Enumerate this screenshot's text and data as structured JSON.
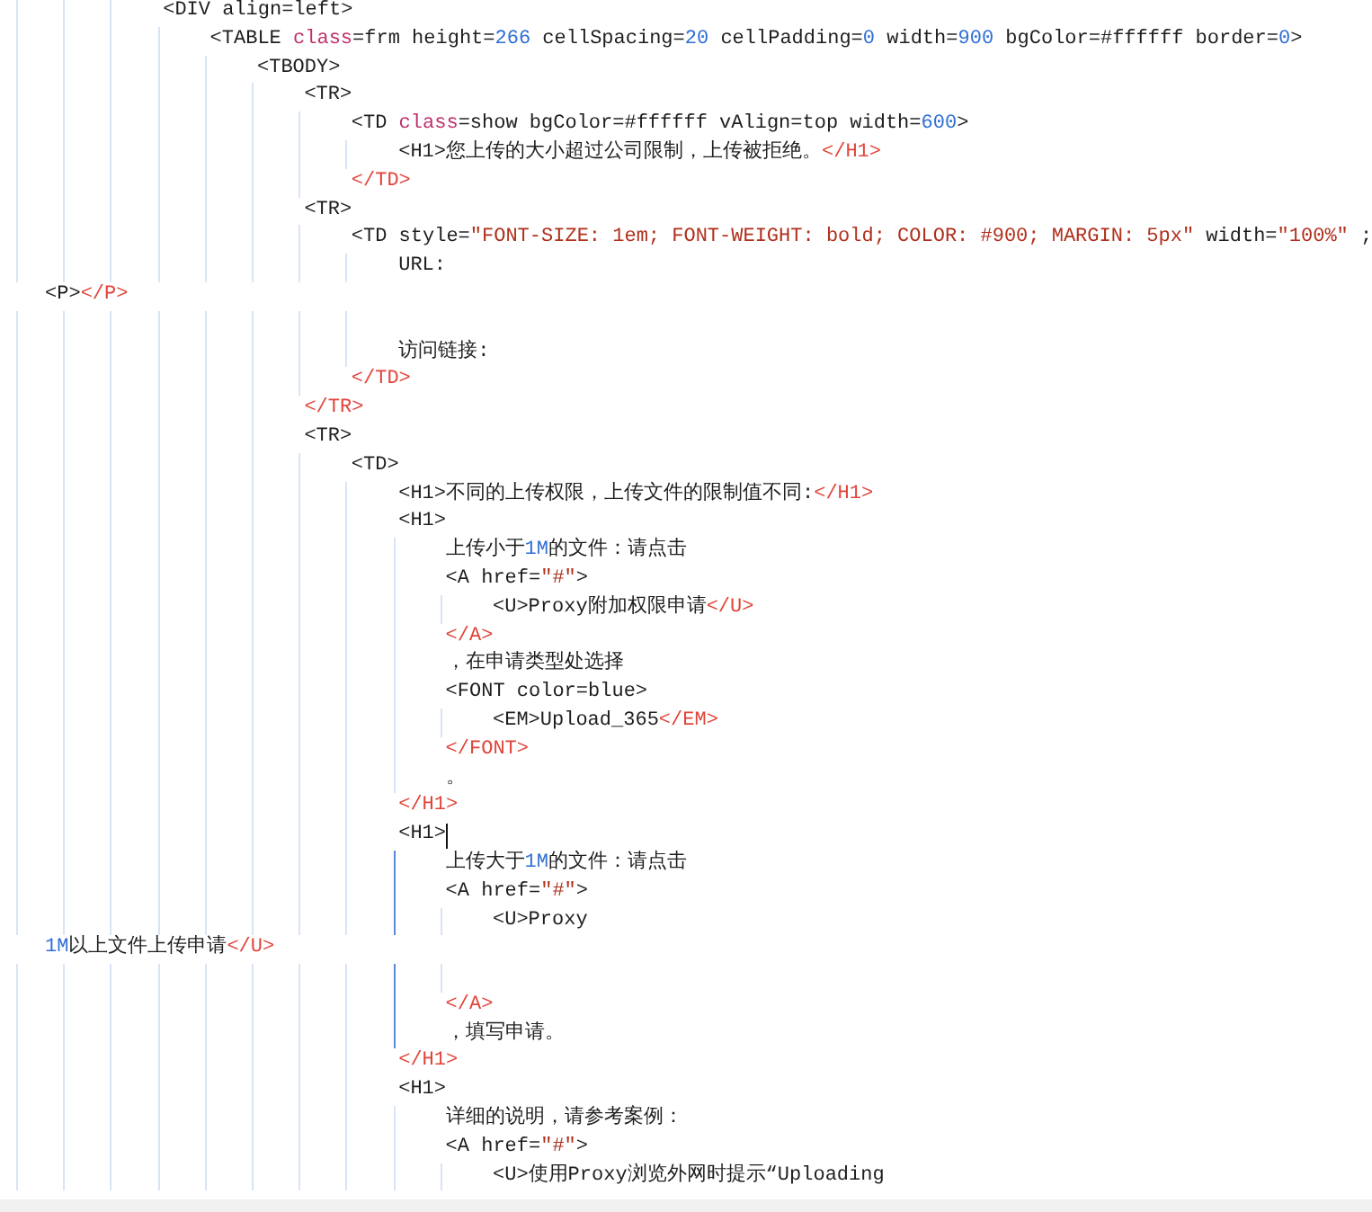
{
  "code_lines": [
    {
      "kind": "code",
      "cursor": false,
      "tokens": [
        {
          "kind": "text",
          "text": "<DIV align=left>"
        }
      ],
      "children": [
        {
          "kind": "code",
          "cursor": false,
          "tokens": [
            {
              "kind": "text",
              "text": "<TABLE "
            },
            {
              "kind": "attr",
              "text": "class"
            },
            {
              "kind": "text",
              "text": "=frm height="
            },
            {
              "kind": "num",
              "text": "266"
            },
            {
              "kind": "text",
              "text": " cellSpacing="
            },
            {
              "kind": "num",
              "text": "20"
            },
            {
              "kind": "text",
              "text": " cellPadding="
            },
            {
              "kind": "num",
              "text": "0"
            },
            {
              "kind": "text",
              "text": " width="
            },
            {
              "kind": "num",
              "text": "900"
            },
            {
              "kind": "text",
              "text": " bgColor=#ffffff border="
            },
            {
              "kind": "num",
              "text": "0"
            },
            {
              "kind": "text",
              "text": ">"
            }
          ],
          "children": [
            {
              "kind": "code",
              "cursor": false,
              "tokens": [
                {
                  "kind": "text",
                  "text": "<TBODY>"
                }
              ],
              "children": [
                {
                  "kind": "code",
                  "cursor": false,
                  "tokens": [
                    {
                      "kind": "text",
                      "text": "<TR>"
                    }
                  ],
                  "children": [
                    {
                      "kind": "code",
                      "cursor": false,
                      "tokens": [
                        {
                          "kind": "text",
                          "text": "<TD "
                        },
                        {
                          "kind": "attr",
                          "text": "class"
                        },
                        {
                          "kind": "text",
                          "text": "=show bgColor=#ffffff vAlign=top width="
                        },
                        {
                          "kind": "num",
                          "text": "600"
                        },
                        {
                          "kind": "text",
                          "text": ">"
                        }
                      ],
                      "children": [
                        {
                          "kind": "code",
                          "cursor": false,
                          "tokens": [
                            {
                              "kind": "text",
                              "text": "<H1>您上传的大小超过公司限制，上传被拒绝。"
                            },
                            {
                              "kind": "close",
                              "text": "</H1>"
                            }
                          ]
                        }
                      ]
                    },
                    {
                      "kind": "code",
                      "cursor": false,
                      "tokens": [
                        {
                          "kind": "close",
                          "text": "</TD>"
                        }
                      ]
                    }
                  ]
                },
                {
                  "kind": "code",
                  "cursor": false,
                  "tokens": [
                    {
                      "kind": "text",
                      "text": "<TR>"
                    }
                  ],
                  "children": [
                    {
                      "kind": "code",
                      "cursor": false,
                      "tokens": [
                        {
                          "kind": "text",
                          "text": "<TD style="
                        },
                        {
                          "kind": "str",
                          "text": "\"FONT-SIZE: 1em; FONT-WEIGHT: bold; COLOR: #900; MARGIN: 5px\""
                        },
                        {
                          "kind": "text",
                          "text": " width="
                        },
                        {
                          "kind": "str",
                          "text": "\"100%\""
                        },
                        {
                          "kind": "text",
                          "text": " ;"
                        }
                      ],
                      "children": [
                        {
                          "kind": "code",
                          "cursor": false,
                          "tokens": [
                            {
                              "kind": "text",
                              "text": "URL:"
                            }
                          ]
                        },
                        {
                          "kind": "wrap",
                          "tokens": [
                            {
                              "kind": "text",
                              "text": "<P>"
                            },
                            {
                              "kind": "close",
                              "text": "</P>"
                            }
                          ]
                        },
                        {
                          "kind": "blank"
                        },
                        {
                          "kind": "code",
                          "cursor": false,
                          "tokens": [
                            {
                              "kind": "text",
                              "text": "访问链接:"
                            }
                          ]
                        }
                      ]
                    },
                    {
                      "kind": "code",
                      "cursor": false,
                      "tokens": [
                        {
                          "kind": "close",
                          "text": "</TD>"
                        }
                      ]
                    }
                  ]
                },
                {
                  "kind": "code",
                  "cursor": false,
                  "tokens": [
                    {
                      "kind": "close",
                      "text": "</TR>"
                    }
                  ]
                },
                {
                  "kind": "code",
                  "cursor": false,
                  "tokens": [
                    {
                      "kind": "text",
                      "text": "<TR>"
                    }
                  ],
                  "children": [
                    {
                      "kind": "code",
                      "cursor": false,
                      "tokens": [
                        {
                          "kind": "text",
                          "text": "<TD>"
                        }
                      ],
                      "children": [
                        {
                          "kind": "code",
                          "cursor": false,
                          "tokens": [
                            {
                              "kind": "text",
                              "text": "<H1>不同的上传权限，上传文件的限制值不同:"
                            },
                            {
                              "kind": "close",
                              "text": "</H1>"
                            }
                          ]
                        },
                        {
                          "kind": "code",
                          "cursor": false,
                          "tokens": [
                            {
                              "kind": "text",
                              "text": "<H1>"
                            }
                          ],
                          "children": [
                            {
                              "kind": "code",
                              "cursor": false,
                              "tokens": [
                                {
                                  "kind": "text",
                                  "text": "上传小于"
                                },
                                {
                                  "kind": "num",
                                  "text": "1M"
                                },
                                {
                                  "kind": "text",
                                  "text": "的文件：请点击"
                                }
                              ]
                            },
                            {
                              "kind": "code",
                              "cursor": false,
                              "tokens": [
                                {
                                  "kind": "text",
                                  "text": "<A href="
                                },
                                {
                                  "kind": "str",
                                  "text": "\"#\""
                                },
                                {
                                  "kind": "text",
                                  "text": ">"
                                }
                              ],
                              "children": [
                                {
                                  "kind": "code",
                                  "cursor": false,
                                  "tokens": [
                                    {
                                      "kind": "text",
                                      "text": "<U>Proxy附加权限申请"
                                    },
                                    {
                                      "kind": "close",
                                      "text": "</U>"
                                    }
                                  ]
                                }
                              ]
                            },
                            {
                              "kind": "code",
                              "cursor": false,
                              "tokens": [
                                {
                                  "kind": "close",
                                  "text": "</A>"
                                }
                              ]
                            },
                            {
                              "kind": "code",
                              "cursor": false,
                              "tokens": [
                                {
                                  "kind": "text",
                                  "text": "，在申请类型处选择"
                                }
                              ]
                            },
                            {
                              "kind": "code",
                              "cursor": false,
                              "tokens": [
                                {
                                  "kind": "text",
                                  "text": "<FONT color=blue>"
                                }
                              ],
                              "children": [
                                {
                                  "kind": "code",
                                  "cursor": false,
                                  "tokens": [
                                    {
                                      "kind": "text",
                                      "text": "<EM>Upload_365"
                                    },
                                    {
                                      "kind": "close",
                                      "text": "</EM>"
                                    }
                                  ]
                                }
                              ]
                            },
                            {
                              "kind": "code",
                              "cursor": false,
                              "tokens": [
                                {
                                  "kind": "close",
                                  "text": "</FONT>"
                                }
                              ]
                            },
                            {
                              "kind": "code",
                              "cursor": false,
                              "tokens": [
                                {
                                  "kind": "text",
                                  "text": "。"
                                }
                              ]
                            }
                          ]
                        },
                        {
                          "kind": "code",
                          "cursor": false,
                          "tokens": [
                            {
                              "kind": "close",
                              "text": "</H1>"
                            }
                          ]
                        },
                        {
                          "kind": "code",
                          "cursor": true,
                          "tokens": [
                            {
                              "kind": "text",
                              "text": "<H1>"
                            }
                          ],
                          "children": [
                            {
                              "kind": "code",
                              "cursor": false,
                              "tokens": [
                                {
                                  "kind": "text",
                                  "text": "上传大于"
                                },
                                {
                                  "kind": "num",
                                  "text": "1M"
                                },
                                {
                                  "kind": "text",
                                  "text": "的文件：请点击"
                                }
                              ]
                            },
                            {
                              "kind": "code",
                              "cursor": false,
                              "tokens": [
                                {
                                  "kind": "text",
                                  "text": "<A href="
                                },
                                {
                                  "kind": "str",
                                  "text": "\"#\""
                                },
                                {
                                  "kind": "text",
                                  "text": ">"
                                }
                              ],
                              "children": [
                                {
                                  "kind": "code",
                                  "cursor": false,
                                  "tokens": [
                                    {
                                      "kind": "text",
                                      "text": "<U>Proxy"
                                    }
                                  ]
                                },
                                {
                                  "kind": "wrap",
                                  "tokens": [
                                    {
                                      "kind": "num",
                                      "text": "1M"
                                    },
                                    {
                                      "kind": "text",
                                      "text": "以上文件上传申请"
                                    },
                                    {
                                      "kind": "close",
                                      "text": "</U>"
                                    }
                                  ]
                                },
                                {
                                  "kind": "blank"
                                }
                              ]
                            },
                            {
                              "kind": "code",
                              "cursor": false,
                              "tokens": [
                                {
                                  "kind": "close",
                                  "text": "</A>"
                                }
                              ]
                            },
                            {
                              "kind": "code",
                              "cursor": false,
                              "tokens": [
                                {
                                  "kind": "text",
                                  "text": "，填写申请。"
                                }
                              ]
                            }
                          ]
                        },
                        {
                          "kind": "code",
                          "cursor": false,
                          "tokens": [
                            {
                              "kind": "close",
                              "text": "</H1>"
                            }
                          ]
                        },
                        {
                          "kind": "code",
                          "cursor": false,
                          "tokens": [
                            {
                              "kind": "text",
                              "text": "<H1>"
                            }
                          ],
                          "children": [
                            {
                              "kind": "code",
                              "cursor": false,
                              "tokens": [
                                {
                                  "kind": "text",
                                  "text": "详细的说明，请参考案例："
                                }
                              ]
                            },
                            {
                              "kind": "code",
                              "cursor": false,
                              "tokens": [
                                {
                                  "kind": "text",
                                  "text": "<A href="
                                },
                                {
                                  "kind": "str",
                                  "text": "\"#\""
                                },
                                {
                                  "kind": "text",
                                  "text": ">"
                                }
                              ],
                              "children": [
                                {
                                  "kind": "code",
                                  "cursor": false,
                                  "tokens": [
                                    {
                                      "kind": "text",
                                      "text": "<U>使用Proxy浏览外网时提示“Uploading"
                                    }
                                  ]
                                }
                              ]
                            }
                          ]
                        }
                      ]
                    }
                  ]
                }
              ]
            }
          ]
        }
      ]
    }
  ]
}
